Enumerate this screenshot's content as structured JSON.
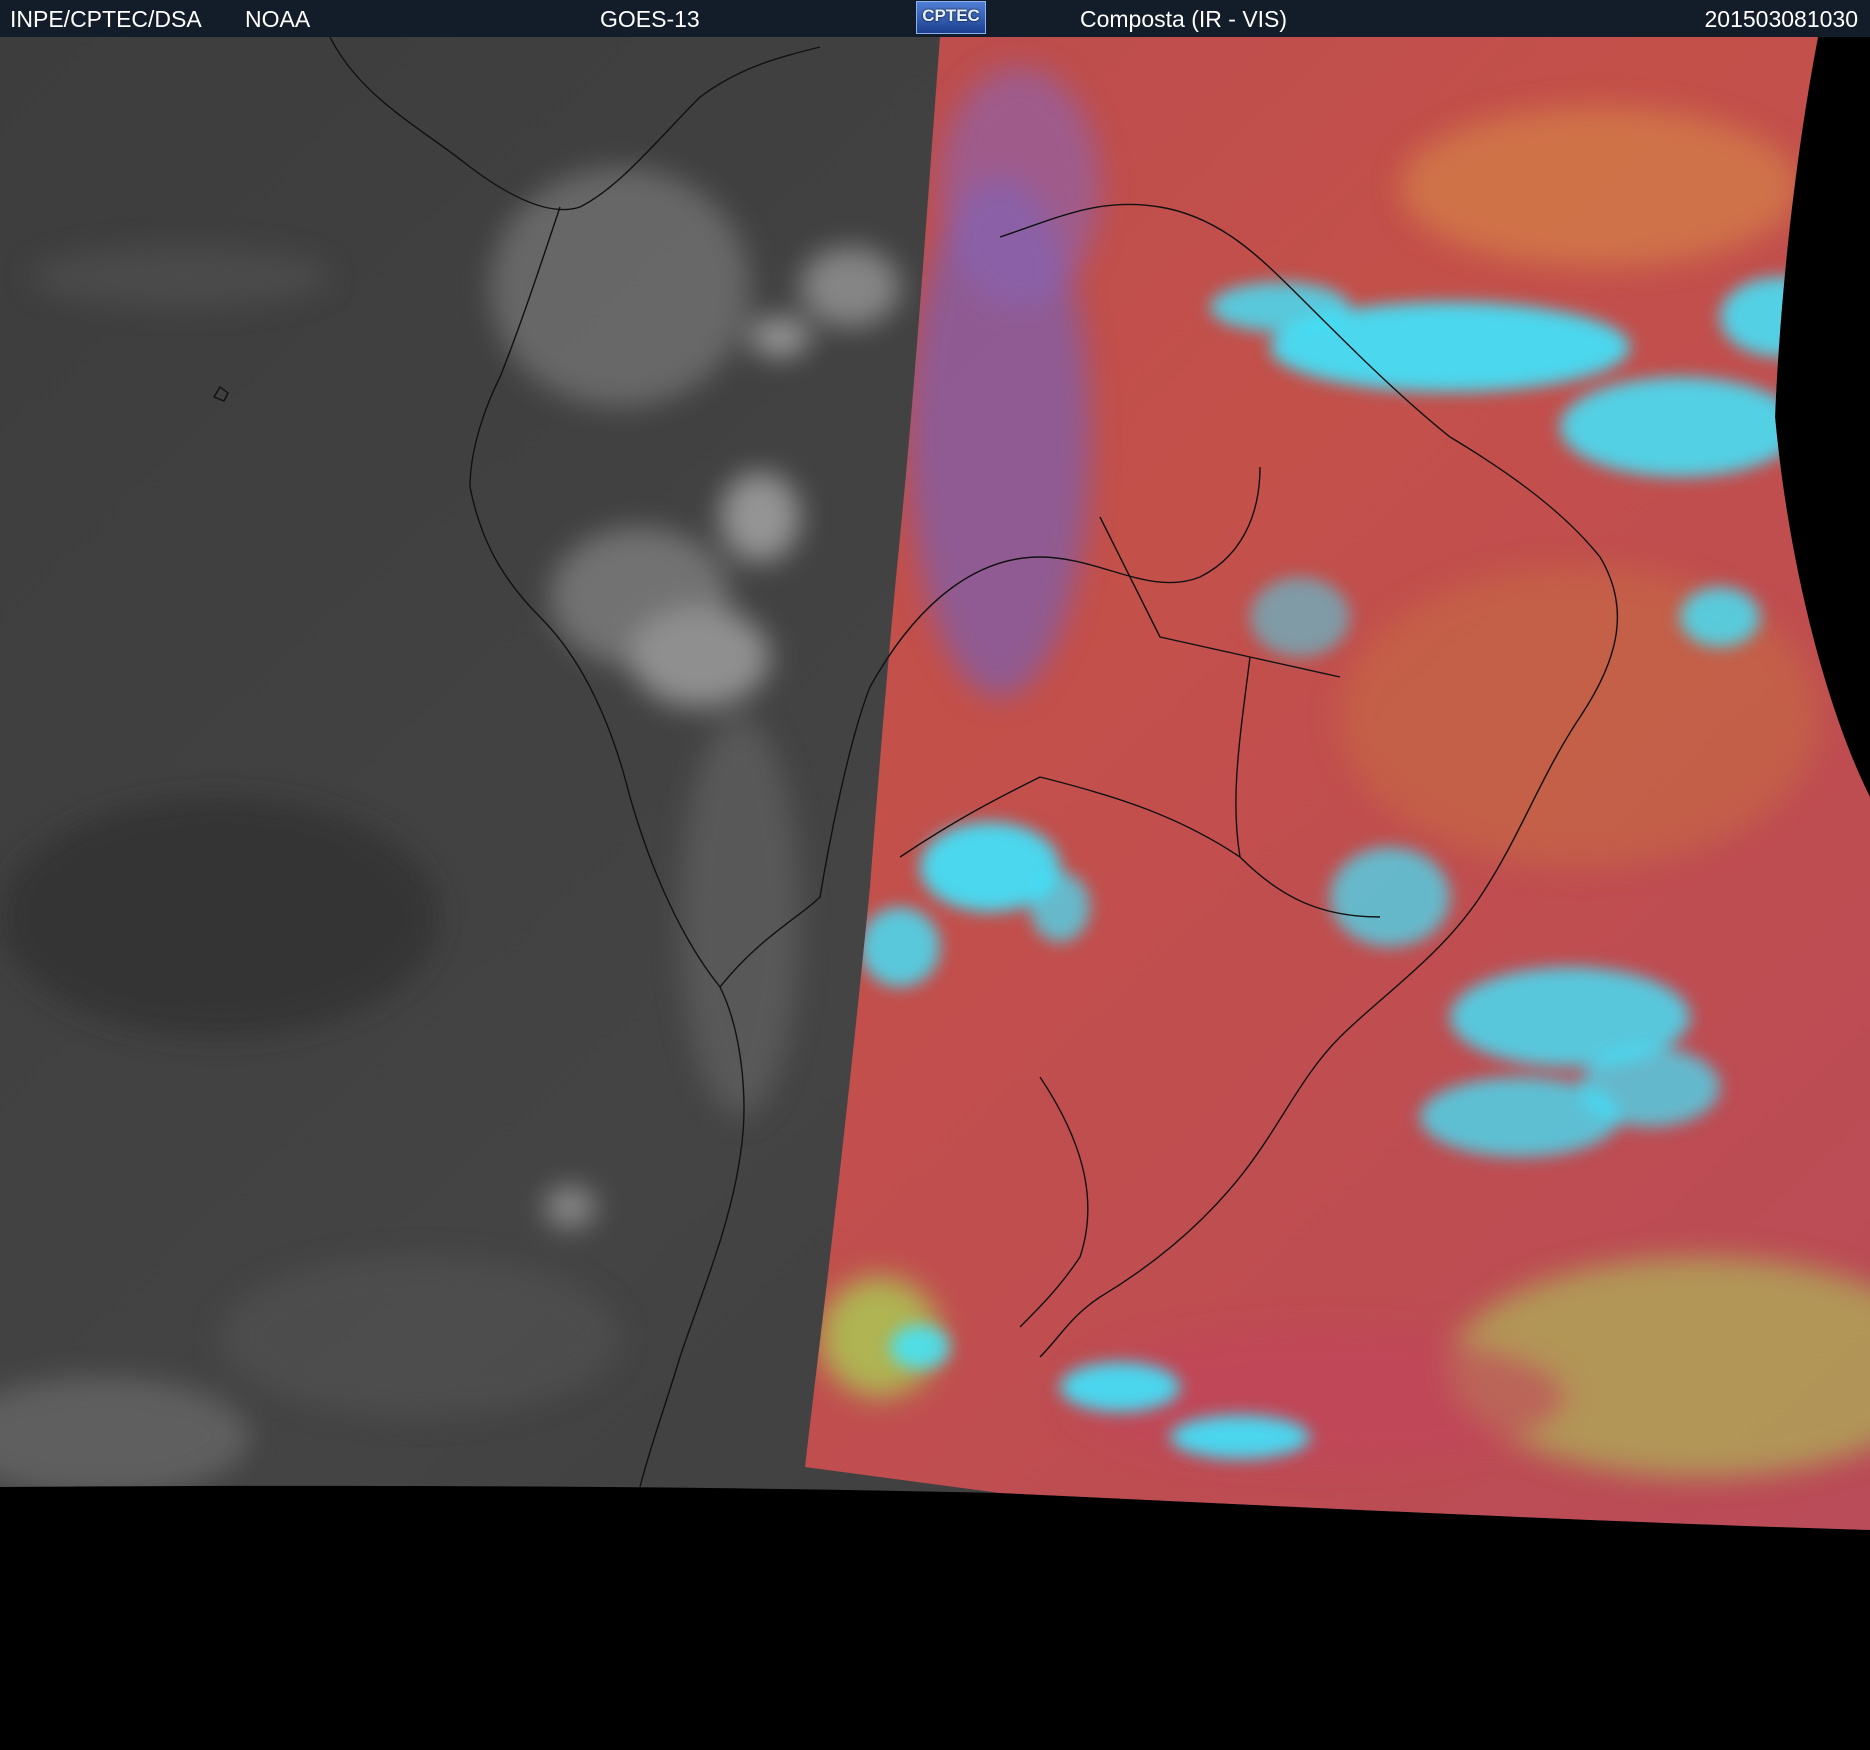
{
  "header": {
    "organization": "INPE/CPTEC/DSA",
    "agency": "NOAA",
    "satellite": "GOES-13",
    "logo_text": "CPTEC",
    "product": "Composta (IR - VIS)",
    "timestamp": "201503081030"
  },
  "colors": {
    "header_bg": "#131d2a",
    "ir_gray": "#3a3a3a",
    "composite_red": "#c0504a",
    "cloud_cyan": "#3ee6ff",
    "cloud_green": "#a8e055",
    "background": "#000000"
  }
}
